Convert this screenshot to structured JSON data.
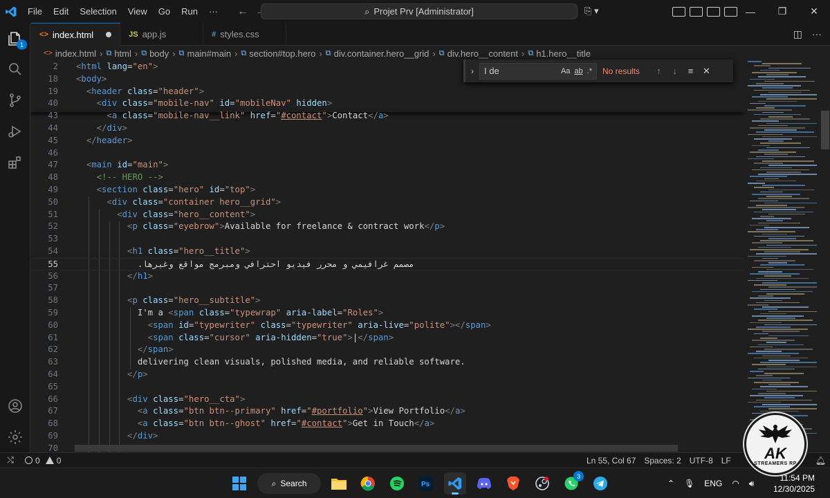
{
  "titlebar": {
    "menus": [
      "File",
      "Edit",
      "Selection",
      "View",
      "Go",
      "Run",
      "···"
    ],
    "command_center": "Projet Prv [Administrator]"
  },
  "activitybar": {
    "explorer_badge": "1"
  },
  "tabs": [
    {
      "label": "index.html",
      "icon": "<>",
      "active": true,
      "modified": true
    },
    {
      "label": "app.js",
      "icon": "JS",
      "active": false
    },
    {
      "label": "styles.css",
      "icon": "#",
      "active": false
    }
  ],
  "breadcrumb": [
    "index.html",
    "html",
    "body",
    "main#main",
    "section#top.hero",
    "div.container.hero__grid",
    "div.hero__content",
    "h1.hero__title"
  ],
  "find": {
    "query": "I de",
    "opt_case": "Aa",
    "opt_word": "ab",
    "opt_regex": ".*",
    "result": "No results"
  },
  "editor": {
    "current_line": "55",
    "lines": [
      {
        "n": "2",
        "html": "<span class=\"t\">&lt;</span><span class=\"tag\">html</span> <span class=\"attr\">lang</span>=<span class=\"str\">\"en\"</span><span class=\"t\">&gt;</span>"
      },
      {
        "n": "18",
        "html": "<span class=\"t\">&lt;</span><span class=\"tag\">body</span><span class=\"t\">&gt;</span>"
      },
      {
        "n": "19",
        "html": "  <span class=\"t\">&lt;</span><span class=\"tag\">header</span> <span class=\"attr\">class</span>=<span class=\"str\">\"header\"</span><span class=\"t\">&gt;</span>"
      },
      {
        "n": "40",
        "html": "    <span class=\"t\">&lt;</span><span class=\"tag\">div</span> <span class=\"attr\">class</span>=<span class=\"str\">\"mobile-nav\"</span> <span class=\"attr\">id</span>=<span class=\"str\">\"mobileNav\"</span> <span class=\"attr\">hidden</span><span class=\"t\">&gt;</span>"
      },
      {
        "n": "43",
        "html": "      <span class=\"t\">&lt;</span><span class=\"tag\">a</span> <span class=\"attr\">class</span>=<span class=\"str\">\"mobile-nav__link\"</span> <span class=\"attr\">href</span>=<span class=\"str\">\"<span class=\"lnk\">#contact</span>\"</span><span class=\"t\">&gt;</span><span class=\"txt\">Contact</span><span class=\"t\">&lt;/</span><span class=\"tag\">a</span><span class=\"t\">&gt;</span>"
      },
      {
        "n": "44",
        "html": "    <span class=\"t\">&lt;/</span><span class=\"tag\">div</span><span class=\"t\">&gt;</span>"
      },
      {
        "n": "45",
        "html": "  <span class=\"t\">&lt;/</span><span class=\"tag\">header</span><span class=\"t\">&gt;</span>"
      },
      {
        "n": "46",
        "html": ""
      },
      {
        "n": "47",
        "html": "  <span class=\"t\">&lt;</span><span class=\"tag\">main</span> <span class=\"attr\">id</span>=<span class=\"str\">\"main\"</span><span class=\"t\">&gt;</span>"
      },
      {
        "n": "48",
        "html": "    <span class=\"cmt\">&lt;!-- HERO --&gt;</span>"
      },
      {
        "n": "49",
        "html": "    <span class=\"t\">&lt;</span><span class=\"tag\">section</span> <span class=\"attr\">class</span>=<span class=\"str\">\"hero\"</span> <span class=\"attr\">id</span>=<span class=\"str\">\"top\"</span><span class=\"t\">&gt;</span>"
      },
      {
        "n": "50",
        "html": "      <span class=\"t\">&lt;</span><span class=\"tag\">div</span> <span class=\"attr\">class</span>=<span class=\"str\">\"container hero__grid\"</span><span class=\"t\">&gt;</span>"
      },
      {
        "n": "51",
        "html": "        <span class=\"t\">&lt;</span><span class=\"tag\">div</span> <span class=\"attr\">class</span>=<span class=\"str\">\"hero__content\"</span><span class=\"t\">&gt;</span>"
      },
      {
        "n": "52",
        "html": "          <span class=\"t\">&lt;</span><span class=\"tag\">p</span> <span class=\"attr\">class</span>=<span class=\"str\">\"eyebrow\"</span><span class=\"t\">&gt;</span><span class=\"txt\">Available for freelance &amp; contract work</span><span class=\"t\">&lt;/</span><span class=\"tag\">p</span><span class=\"t\">&gt;</span>"
      },
      {
        "n": "53",
        "html": ""
      },
      {
        "n": "54",
        "html": "          <span class=\"t\">&lt;</span><span class=\"tag\">h1</span> <span class=\"attr\">class</span>=<span class=\"str\">\"hero__title\"</span><span class=\"t\">&gt;</span>"
      },
      {
        "n": "55",
        "html": "            <span class=\"txt\">.مصمم غرافيمي و محرر فيديو احترافي ومبرمج مواقع وغيرها</span>"
      },
      {
        "n": "56",
        "html": "          <span class=\"t\">&lt;/</span><span class=\"tag\">h1</span><span class=\"t\">&gt;</span>"
      },
      {
        "n": "57",
        "html": ""
      },
      {
        "n": "58",
        "html": "          <span class=\"t\">&lt;</span><span class=\"tag\">p</span> <span class=\"attr\">class</span>=<span class=\"str\">\"hero__subtitle\"</span><span class=\"t\">&gt;</span>"
      },
      {
        "n": "59",
        "html": "            <span class=\"txt\">I'm a </span><span class=\"t\">&lt;</span><span class=\"tag\">span</span> <span class=\"attr\">class</span>=<span class=\"str\">\"typewrap\"</span> <span class=\"attr\">aria-label</span>=<span class=\"str\">\"Roles\"</span><span class=\"t\">&gt;</span>"
      },
      {
        "n": "60",
        "html": "              <span class=\"t\">&lt;</span><span class=\"tag\">span</span> <span class=\"attr\">id</span>=<span class=\"str\">\"typewriter\"</span> <span class=\"attr\">class</span>=<span class=\"str\">\"typewriter\"</span> <span class=\"attr\">aria-live</span>=<span class=\"str\">\"polite\"</span><span class=\"t\">&gt;&lt;/</span><span class=\"tag\">span</span><span class=\"t\">&gt;</span>"
      },
      {
        "n": "61",
        "html": "              <span class=\"t\">&lt;</span><span class=\"tag\">span</span> <span class=\"attr\">class</span>=<span class=\"str\">\"cursor\"</span> <span class=\"attr\">aria-hidden</span>=<span class=\"str\">\"true\"</span><span class=\"t\">&gt;</span><span class=\"txt\">|</span><span class=\"t\">&lt;/</span><span class=\"tag\">span</span><span class=\"t\">&gt;</span>"
      },
      {
        "n": "62",
        "html": "            <span class=\"t\">&lt;/</span><span class=\"tag\">span</span><span class=\"t\">&gt;</span>"
      },
      {
        "n": "63",
        "html": "            <span class=\"txt\">delivering clean visuals, polished media, and reliable software.</span>"
      },
      {
        "n": "64",
        "html": "          <span class=\"t\">&lt;/</span><span class=\"tag\">p</span><span class=\"t\">&gt;</span>"
      },
      {
        "n": "65",
        "html": ""
      },
      {
        "n": "66",
        "html": "          <span class=\"t\">&lt;</span><span class=\"tag\">div</span> <span class=\"attr\">class</span>=<span class=\"str\">\"hero__cta\"</span><span class=\"t\">&gt;</span>"
      },
      {
        "n": "67",
        "html": "            <span class=\"t\">&lt;</span><span class=\"tag\">a</span> <span class=\"attr\">class</span>=<span class=\"str\">\"btn btn--primary\"</span> <span class=\"attr\">href</span>=<span class=\"str\">\"<span class=\"lnk\">#portfolio</span>\"</span><span class=\"t\">&gt;</span><span class=\"txt\">View Portfolio</span><span class=\"t\">&lt;/</span><span class=\"tag\">a</span><span class=\"t\">&gt;</span>"
      },
      {
        "n": "68",
        "html": "            <span class=\"t\">&lt;</span><span class=\"tag\">a</span> <span class=\"attr\">class</span>=<span class=\"str\">\"btn btn--ghost\"</span> <span class=\"attr\">href</span>=<span class=\"str\">\"<span class=\"lnk\">#contact</span>\"</span><span class=\"t\">&gt;</span><span class=\"txt\">Get in Touch</span><span class=\"t\">&lt;/</span><span class=\"tag\">a</span><span class=\"t\">&gt;</span>"
      },
      {
        "n": "69",
        "html": "          <span class=\"t\">&lt;/</span><span class=\"tag\">div</span><span class=\"t\">&gt;</span>"
      },
      {
        "n": "70",
        "html": ""
      }
    ]
  },
  "statusbar": {
    "errors": "0",
    "warnings": "0",
    "position": "Ln 55, Col 67",
    "spaces": "Spaces: 2",
    "encoding": "UTF-8",
    "eol": "LF"
  },
  "taskbar": {
    "search_label": "Search",
    "steam_badge": "3",
    "language": "ENG",
    "time": "11:54 PM",
    "date": "12/30/2025"
  },
  "watermark": {
    "title": "AK",
    "subtitle": "STREAMERS RP"
  },
  "colors": {
    "accent": "#0078d4",
    "tag": "#569cd6",
    "attr": "#9cdcfe",
    "string": "#ce9178",
    "comment": "#6a9955",
    "no_results": "#f48771"
  }
}
